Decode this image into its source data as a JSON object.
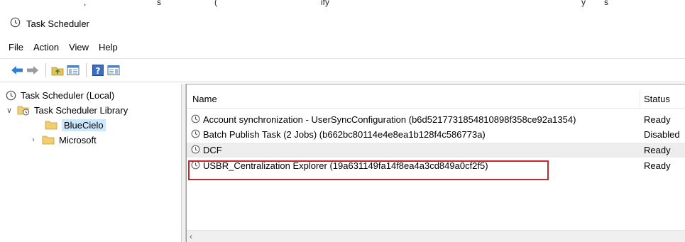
{
  "window": {
    "title": "Task Scheduler"
  },
  "top_fragments": [
    ",",
    "s",
    "(",
    "ify",
    "y",
    "s"
  ],
  "menu": {
    "items": [
      "File",
      "Action",
      "View",
      "Help"
    ]
  },
  "toolbar": {
    "buttons": [
      "back-arrow-icon",
      "forward-arrow-icon",
      "up-folder-icon",
      "show-hide-console-tree-icon",
      "help-icon",
      "show-hide-action-pane-icon"
    ]
  },
  "tree": {
    "items": [
      {
        "label": "Task Scheduler (Local)",
        "icon": "clock-icon"
      },
      {
        "label": "Task Scheduler Library",
        "icon": "library-folder-icon",
        "expanded": true
      },
      {
        "label": "BlueCielo",
        "icon": "folder-icon",
        "selected": true
      },
      {
        "label": "Microsoft",
        "icon": "folder-icon",
        "expanded": false
      }
    ]
  },
  "table": {
    "columns": [
      "Name",
      "Status"
    ],
    "rows": [
      {
        "name": "Account synchronization - UserSyncConfiguration (b6d5217731854810898f358ce92a1354)",
        "status": "Ready"
      },
      {
        "name": "Batch Publish Task (2 Jobs) (b662bc80114e4e8ea1b128f4c586773a)",
        "status": "Disabled"
      },
      {
        "name": "DCF",
        "status": "Ready"
      },
      {
        "name": "USBR_Centralization Explorer (19a631149fa14f8ea4a3cd849a0cf2f5)",
        "status": "Ready"
      }
    ]
  },
  "colors": {
    "highlight_box": "#c1272d",
    "selection": "#cce8ff"
  }
}
